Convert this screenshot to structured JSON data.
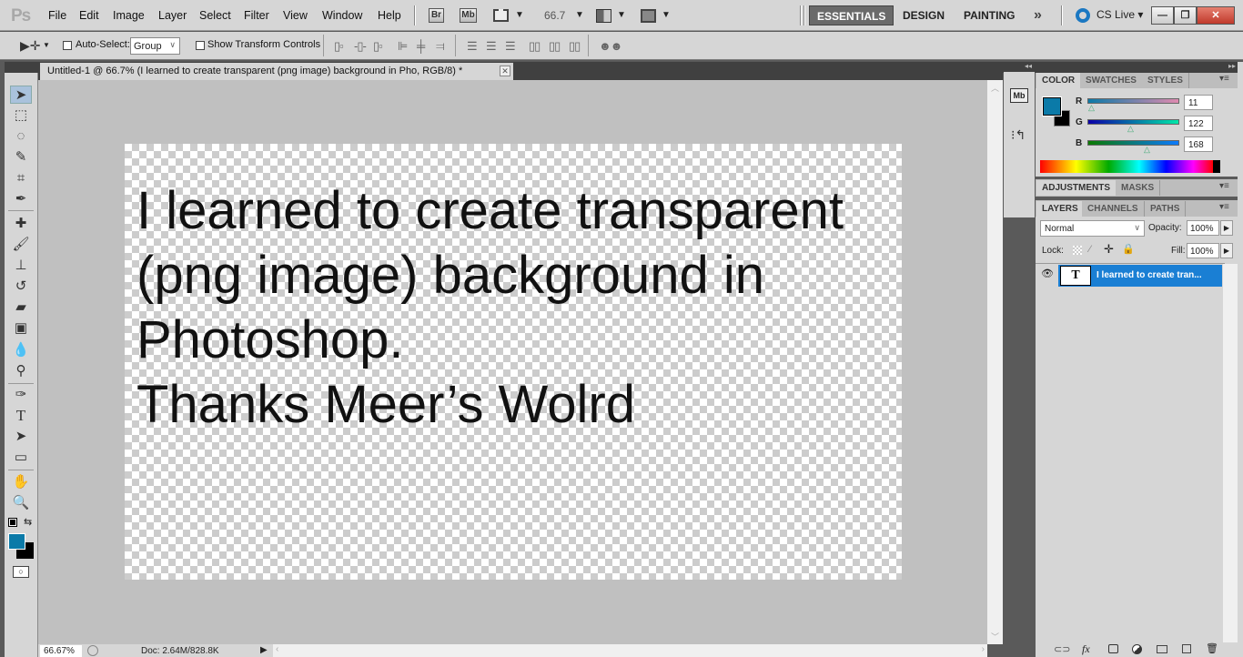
{
  "app": {
    "logo": "Ps"
  },
  "menu": [
    "File",
    "Edit",
    "Image",
    "Layer",
    "Select",
    "Filter",
    "View",
    "Window",
    "Help"
  ],
  "appbar": {
    "bridge": "Br",
    "minibridge": "Mb",
    "zoom": "66.7",
    "workspaces": [
      "ESSENTIALS",
      "DESIGN",
      "PAINTING"
    ],
    "more": "»",
    "cslive": "CS Live ▾",
    "minimize": "—",
    "restore": "❐",
    "close": "✕"
  },
  "options": {
    "auto_select_label": "Auto-Select:",
    "auto_select_value": "Group",
    "transform_label": "Show Transform Controls"
  },
  "document": {
    "tab_title": "Untitled-1 @ 66.7% (I learned to create transparent  (png image) background in  Pho, RGB/8) *",
    "close": "✕",
    "text": "I learned to create transparent\n(png image) background in\nPhotoshop.\nThanks Meer’s Wolrd"
  },
  "status": {
    "zoom": "66.67%",
    "doc": "Doc: 2.64M/828.8K"
  },
  "color_panel": {
    "tabs": [
      "COLOR",
      "SWATCHES",
      "STYLES"
    ],
    "foreground": "#0b7aa8",
    "background": "#000000",
    "channels": [
      {
        "label": "R",
        "value": "11"
      },
      {
        "label": "G",
        "value": "122"
      },
      {
        "label": "B",
        "value": "168"
      }
    ]
  },
  "adjustments_panel": {
    "tabs": [
      "ADJUSTMENTS",
      "MASKS"
    ]
  },
  "layers_panel": {
    "tabs": [
      "LAYERS",
      "CHANNELS",
      "PATHS"
    ],
    "blend_mode": "Normal",
    "opacity_label": "Opacity:",
    "opacity": "100%",
    "lock_label": "Lock:",
    "fill_label": "Fill:",
    "fill": "100%",
    "layers": [
      {
        "name": "I learned to create tran...",
        "thumb": "T",
        "selected": true
      }
    ]
  }
}
